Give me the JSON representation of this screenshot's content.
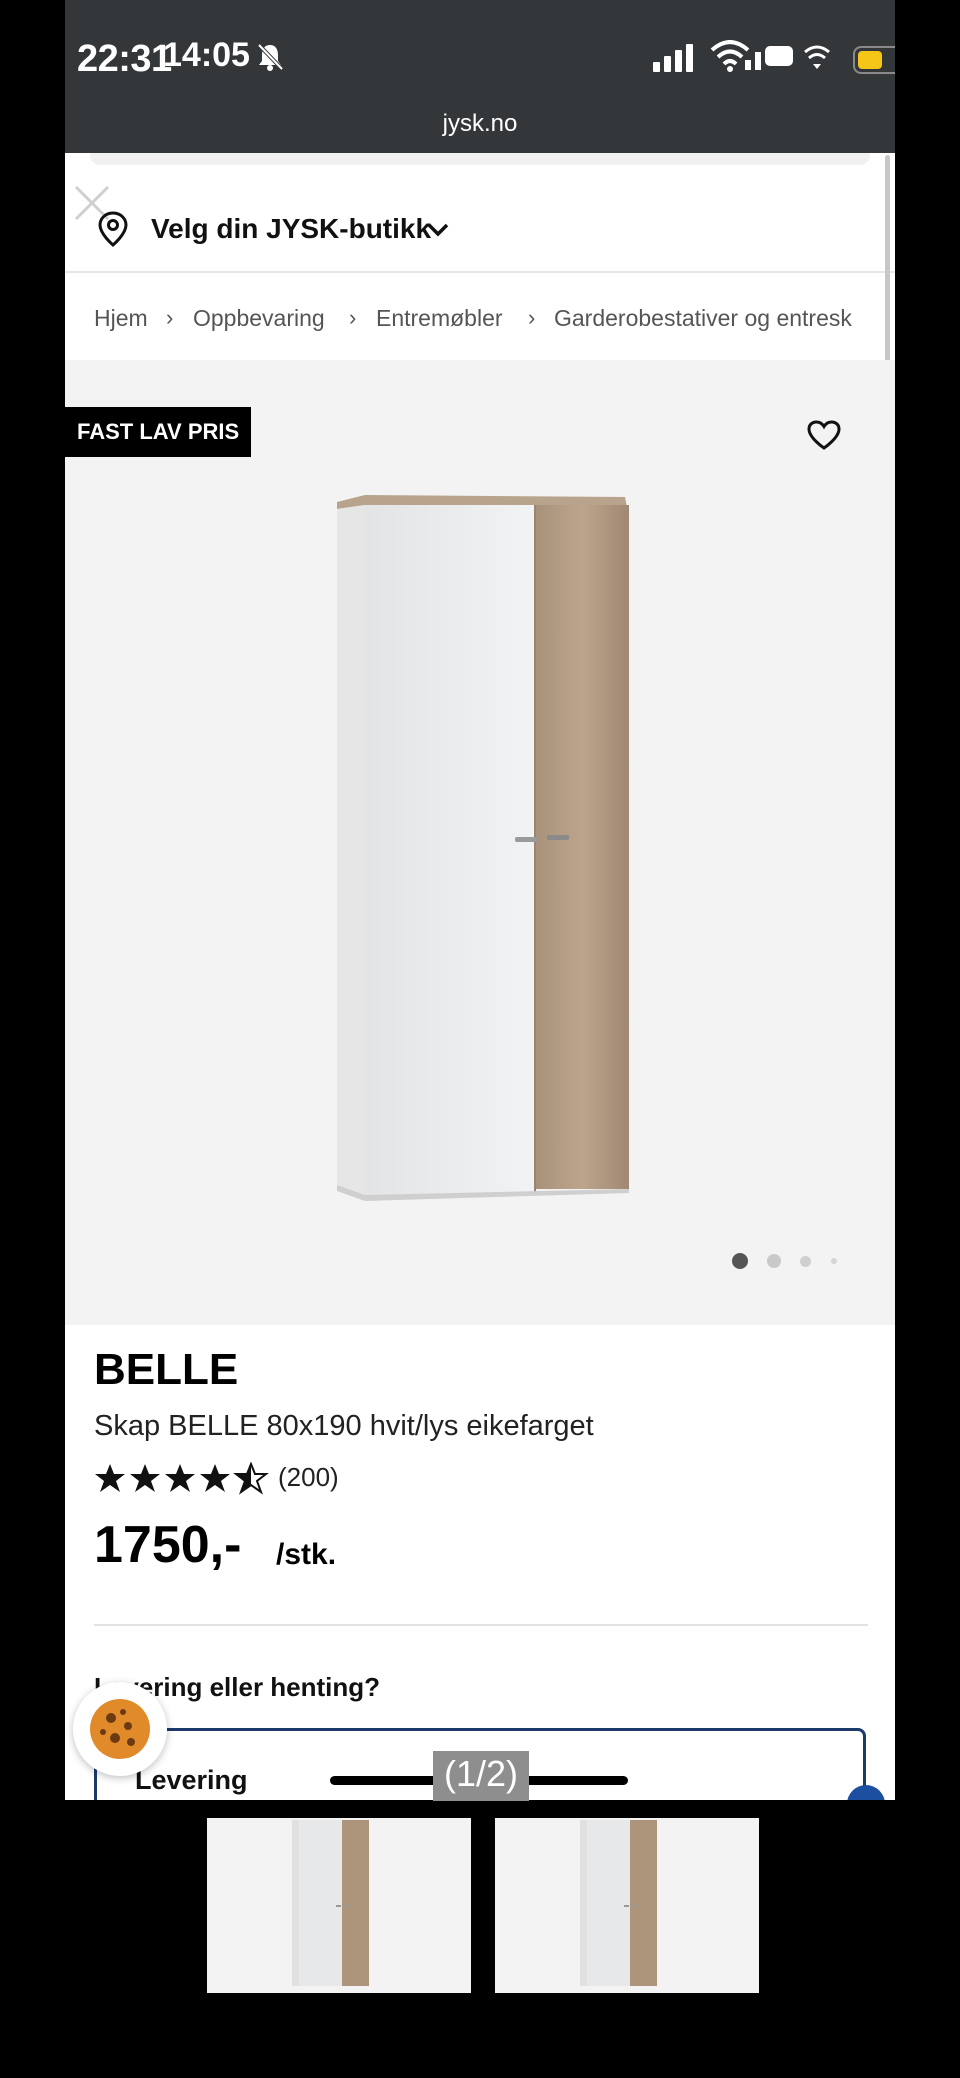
{
  "status_bar": {
    "time_primary": "22:31",
    "time_secondary": "14:05",
    "url": "jysk.no"
  },
  "store_selector": {
    "label": "Velg din JYSK-butikk"
  },
  "breadcrumb": {
    "items": [
      "Hjem",
      "Oppbevaring",
      "Entremøbler",
      "Garderobestativer og entresk"
    ]
  },
  "gallery": {
    "badge": "FAST LAV PRIS",
    "current_image": 1,
    "image_count": 4
  },
  "product": {
    "brand": "BELLE",
    "name": "Skap BELLE 80x190 hvit/lys eikefarget",
    "rating": 4.5,
    "reviews": "(200)",
    "price": "1750,-",
    "unit": "/stk."
  },
  "delivery": {
    "heading": "Levering eller henting?",
    "option_label": "Levering"
  },
  "viewer": {
    "page_indicator": "(1/2)"
  },
  "colors": {
    "status_bg": "#34373a",
    "gallery_bg": "#f3f3f3",
    "accent_blue": "#1c3a6b",
    "wood": "#b39c82"
  }
}
